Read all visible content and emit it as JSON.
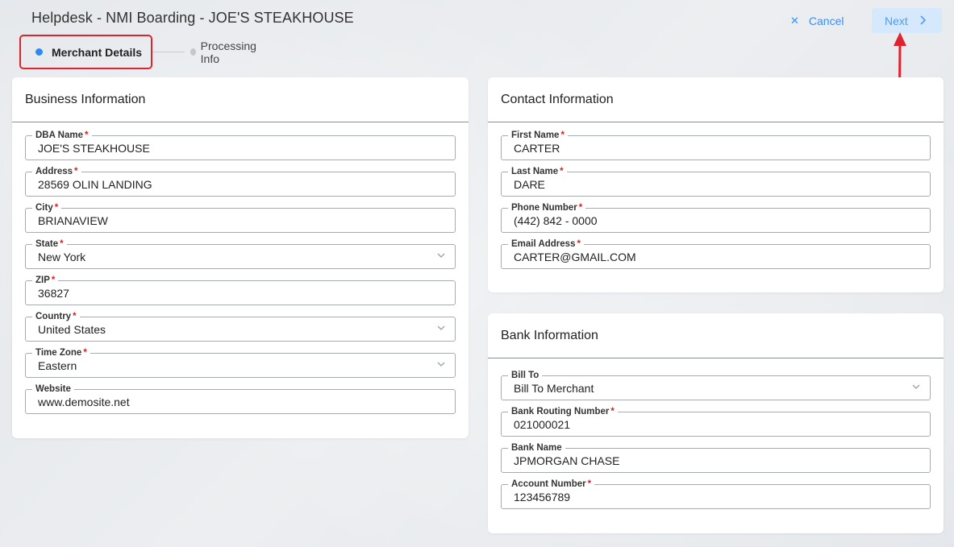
{
  "header": {
    "title": "Helpdesk - NMI Boarding - JOE'S STEAKHOUSE",
    "cancel_label": "Cancel",
    "next_label": "Next"
  },
  "stepper": {
    "steps": [
      {
        "label": "Merchant Details",
        "active": true
      },
      {
        "label": "Processing Info",
        "active": false
      }
    ]
  },
  "business": {
    "title": "Business Information",
    "fields": [
      {
        "label": "DBA Name",
        "required": true,
        "value": "JOE'S STEAKHOUSE",
        "type": "text"
      },
      {
        "label": "Address",
        "required": true,
        "value": "28569 OLIN LANDING",
        "type": "text"
      },
      {
        "label": "City",
        "required": true,
        "value": "BRIANAVIEW",
        "type": "text"
      },
      {
        "label": "State",
        "required": true,
        "value": "New York",
        "type": "select"
      },
      {
        "label": "ZIP",
        "required": true,
        "value": "36827",
        "type": "text"
      },
      {
        "label": "Country",
        "required": true,
        "value": "United States",
        "type": "select"
      },
      {
        "label": "Time Zone",
        "required": true,
        "value": "Eastern",
        "type": "select"
      },
      {
        "label": "Website",
        "required": false,
        "value": "www.demosite.net",
        "type": "text"
      }
    ]
  },
  "contact": {
    "title": "Contact Information",
    "fields": [
      {
        "label": "First Name",
        "required": true,
        "value": "CARTER",
        "type": "text"
      },
      {
        "label": "Last Name",
        "required": true,
        "value": "DARE",
        "type": "text"
      },
      {
        "label": "Phone Number",
        "required": true,
        "value": "(442) 842 - 0000",
        "type": "text"
      },
      {
        "label": "Email Address",
        "required": true,
        "value": "CARTER@GMAIL.COM",
        "type": "text"
      }
    ]
  },
  "bank": {
    "title": "Bank Information",
    "fields": [
      {
        "label": "Bill To",
        "required": false,
        "value": "Bill To Merchant",
        "type": "select"
      },
      {
        "label": "Bank Routing Number",
        "required": true,
        "value": "021000021",
        "type": "text"
      },
      {
        "label": "Bank Name",
        "required": false,
        "value": "JPMORGAN CHASE",
        "type": "text"
      },
      {
        "label": "Account Number",
        "required": true,
        "value": "123456789",
        "type": "text"
      }
    ]
  },
  "colors": {
    "accent": "#2f8af0",
    "highlight_border": "#e0242f",
    "required": "#d8202a",
    "next_bg": "#d6e8fb"
  },
  "icons": {
    "cancel": "close-icon",
    "next": "chevron-right-icon",
    "select": "chevron-down-icon",
    "annotation": "red-arrow-icon"
  }
}
